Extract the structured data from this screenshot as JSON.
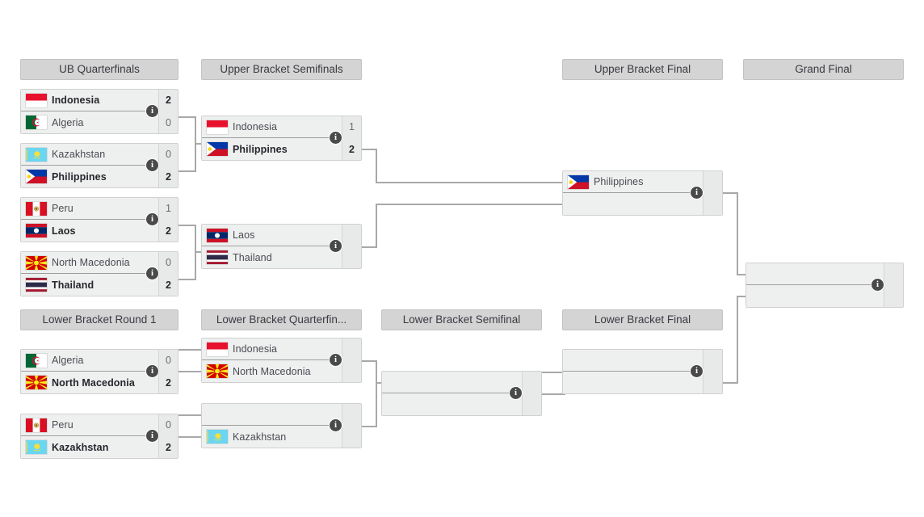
{
  "rounds": [
    {
      "id": "ub-quarterfinals",
      "label": "UB Quarterfinals"
    },
    {
      "id": "ub-semifinals",
      "label": "Upper Bracket Semifinals"
    },
    {
      "id": "ub-final",
      "label": "Upper Bracket Final"
    },
    {
      "id": "grand-final",
      "label": "Grand Final"
    },
    {
      "id": "lb-round-1",
      "label": "Lower Bracket Round 1"
    },
    {
      "id": "lb-quarterfinals",
      "label": "Lower Bracket Quarterfin..."
    },
    {
      "id": "lb-semifinal",
      "label": "Lower Bracket Semifinal"
    },
    {
      "id": "lb-final",
      "label": "Lower Bracket Final"
    }
  ],
  "info_icon": "i",
  "matches": {
    "ubqf1": {
      "top": {
        "team": "Indonesia",
        "flag": "indonesia",
        "score": "2",
        "winner": true
      },
      "bottom": {
        "team": "Algeria",
        "flag": "algeria",
        "score": "0",
        "winner": false
      }
    },
    "ubqf2": {
      "top": {
        "team": "Kazakhstan",
        "flag": "kazakhstan",
        "score": "0",
        "winner": false
      },
      "bottom": {
        "team": "Philippines",
        "flag": "philippines",
        "score": "2",
        "winner": true
      }
    },
    "ubqf3": {
      "top": {
        "team": "Peru",
        "flag": "peru",
        "score": "1",
        "winner": false
      },
      "bottom": {
        "team": "Laos",
        "flag": "laos",
        "score": "2",
        "winner": true
      }
    },
    "ubqf4": {
      "top": {
        "team": "North Macedonia",
        "flag": "north-macedonia",
        "score": "0",
        "winner": false
      },
      "bottom": {
        "team": "Thailand",
        "flag": "thailand",
        "score": "2",
        "winner": true
      }
    },
    "ubsf1": {
      "top": {
        "team": "Indonesia",
        "flag": "indonesia",
        "score": "1",
        "winner": false
      },
      "bottom": {
        "team": "Philippines",
        "flag": "philippines",
        "score": "2",
        "winner": true
      }
    },
    "ubsf2": {
      "top": {
        "team": "Laos",
        "flag": "laos",
        "score": "",
        "winner": false
      },
      "bottom": {
        "team": "Thailand",
        "flag": "thailand",
        "score": "",
        "winner": false
      }
    },
    "ubf": {
      "top": {
        "team": "Philippines",
        "flag": "philippines",
        "score": "",
        "winner": false
      },
      "bottom": {
        "team": "",
        "flag": "",
        "score": "",
        "winner": false
      }
    },
    "gf": {
      "top": {
        "team": "",
        "flag": "",
        "score": "",
        "winner": false
      },
      "bottom": {
        "team": "",
        "flag": "",
        "score": "",
        "winner": false
      }
    },
    "lbr1m1": {
      "top": {
        "team": "Algeria",
        "flag": "algeria",
        "score": "0",
        "winner": false
      },
      "bottom": {
        "team": "North Macedonia",
        "flag": "north-macedonia",
        "score": "2",
        "winner": true
      }
    },
    "lbr1m2": {
      "top": {
        "team": "Peru",
        "flag": "peru",
        "score": "0",
        "winner": false
      },
      "bottom": {
        "team": "Kazakhstan",
        "flag": "kazakhstan",
        "score": "2",
        "winner": true
      }
    },
    "lbqf1": {
      "top": {
        "team": "Indonesia",
        "flag": "indonesia",
        "score": "",
        "winner": false
      },
      "bottom": {
        "team": "North Macedonia",
        "flag": "north-macedonia",
        "score": "",
        "winner": false
      }
    },
    "lbqf2": {
      "top": {
        "team": "",
        "flag": "",
        "score": "",
        "winner": false
      },
      "bottom": {
        "team": "Kazakhstan",
        "flag": "kazakhstan",
        "score": "",
        "winner": false
      }
    },
    "lbsf": {
      "top": {
        "team": "",
        "flag": "",
        "score": "",
        "winner": false
      },
      "bottom": {
        "team": "",
        "flag": "",
        "score": "",
        "winner": false
      }
    },
    "lbf": {
      "top": {
        "team": "",
        "flag": "",
        "score": "",
        "winner": false
      },
      "bottom": {
        "team": "",
        "flag": "",
        "score": "",
        "winner": false
      }
    }
  },
  "colors": {
    "header_bg": "#d4d4d4",
    "match_bg": "#eef0ef",
    "score_bg": "#e8eae9",
    "connector": "#a8a8a8",
    "badge_bg": "#4a4a4a"
  }
}
